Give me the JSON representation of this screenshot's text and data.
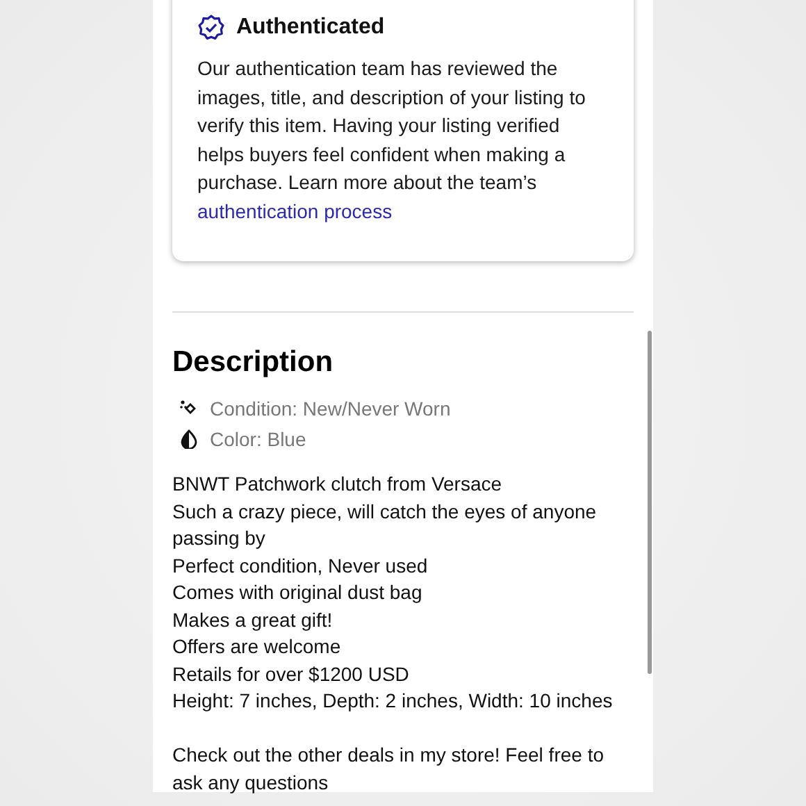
{
  "auth_card": {
    "title": "Authenticated",
    "body": "Our authentication team has reviewed the images, title, and description of your listing to verify this item. Having your listing verified helps buyers feel confident when making a purchase. Learn more about the team’s ",
    "link": "authentication process"
  },
  "description": {
    "title": "Description",
    "attributes": [
      {
        "kind": "condition",
        "text": "Condition: New/Never Worn"
      },
      {
        "kind": "color",
        "text": "Color: Blue"
      }
    ],
    "paragraphs": [
      [
        "BNWT Patchwork clutch from Versace",
        "Such a crazy piece, will catch the eyes of anyone passing by",
        "Perfect condition, Never used",
        "Comes with original dust bag",
        "Makes a great gift!",
        "Offers are welcome",
        "Retails for over $1200 USD",
        "Height: 7 inches, Depth: 2 inches, Width: 10 inches"
      ],
      [
        "Check out the other deals in my store! Feel free to ask any questions"
      ]
    ]
  }
}
